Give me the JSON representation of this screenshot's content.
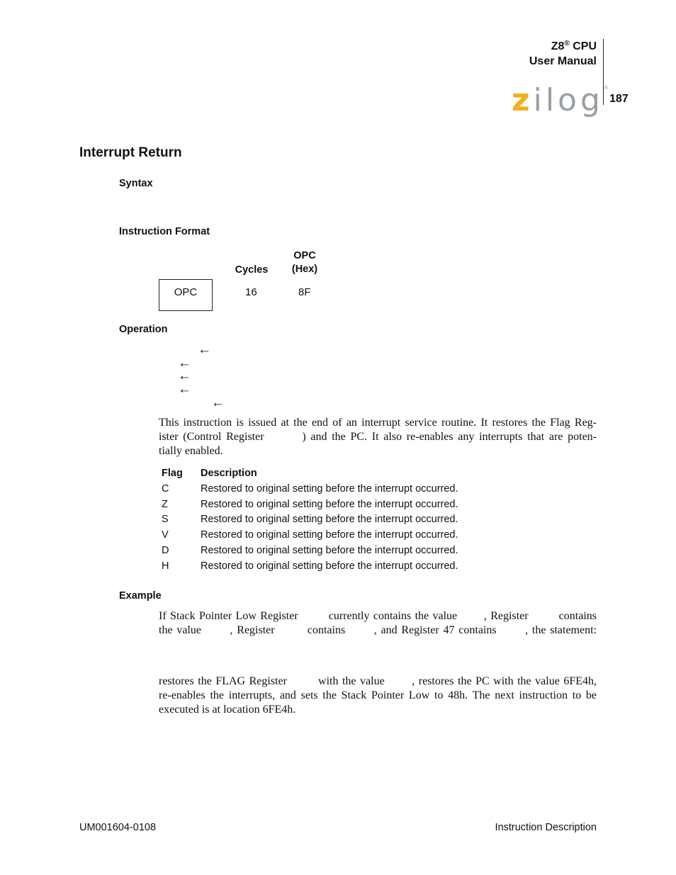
{
  "header": {
    "product": "Z8",
    "product_mark": "®",
    "product_suffix": " CPU",
    "doc_title": "User Manual",
    "logo": {
      "first_letter": "z",
      "rest": "ilog",
      "mark": "®",
      "accent_color": "#f5ae1c",
      "gray_color": "#9a9fa3"
    },
    "page_number": "187"
  },
  "title": "Interrupt Return",
  "sections": {
    "syntax": "Syntax",
    "instruction_format": "Instruction Format",
    "operation": "Operation",
    "example": "Example"
  },
  "instruction_format": {
    "headers": {
      "cycles": "Cycles",
      "opc_line1": "OPC",
      "opc_line2": "(Hex)"
    },
    "box_label": "OPC",
    "cycles": "16",
    "opc_hex": "8F"
  },
  "operation": {
    "arrows": [
      "←",
      "←",
      "←",
      "←",
      "←"
    ]
  },
  "description": "This instruction is issued at the end of an interrupt service routine. It restores the Flag Reg-ister (Control Register         ) and the PC. It also re-enables any interrupts that are poten-tially enabled.",
  "description_lines": [
    "This instruction is issued at the end of an interrupt service routine. It restores the Flag Reg-",
    "ister (Control Register        ) and the PC. It also re-enables any interrupts that are poten-",
    "tially enabled."
  ],
  "flags": {
    "headers": {
      "flag": "Flag",
      "description": "Description"
    },
    "rows": [
      {
        "flag": "C",
        "description": "Restored to original setting before the interrupt occurred."
      },
      {
        "flag": "Z",
        "description": "Restored to original setting before the interrupt occurred."
      },
      {
        "flag": "S",
        "description": "Restored to original setting before the interrupt occurred."
      },
      {
        "flag": "V",
        "description": "Restored to original setting before the interrupt occurred."
      },
      {
        "flag": "D",
        "description": "Restored to original setting before the interrupt occurred."
      },
      {
        "flag": "H",
        "description": "Restored to original setting before the interrupt occurred."
      }
    ]
  },
  "example": {
    "intro_lines": [
      "If Stack Pointer Low Register        currently contains the value       , Register        contains",
      "the value       , Register        contains       , and Register 47 contains       , the statement:"
    ],
    "result_lines": [
      "restores the FLAG Register        with the value       , restores the PC with the value 6FE4h,",
      "re-enables the interrupts, and sets the Stack Pointer Low to 48h. The next instruction to be",
      "executed is at location 6FE4h."
    ]
  },
  "footer": {
    "doc_id": "UM001604-0108",
    "section": "Instruction Description"
  }
}
